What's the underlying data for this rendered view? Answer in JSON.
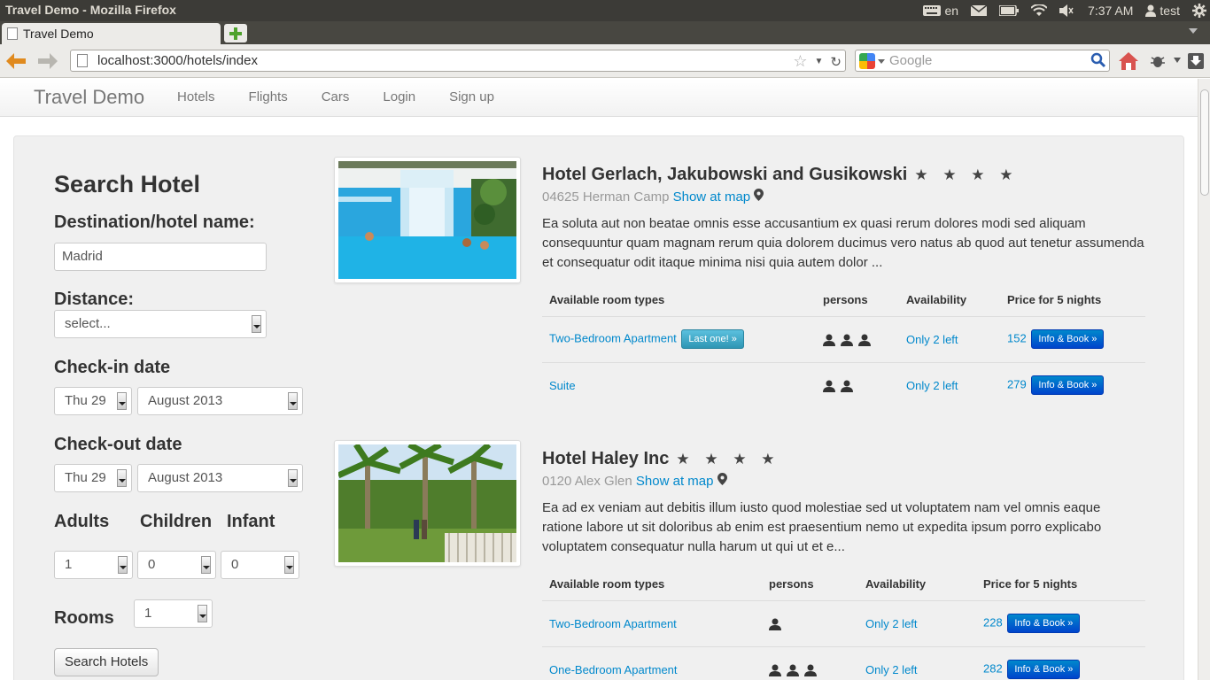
{
  "window": {
    "title": "Travel Demo - Mozilla Firefox",
    "tray": {
      "keyboard_layout": "en",
      "clock": "7:37 AM",
      "user": "test"
    }
  },
  "browser": {
    "tab_title": "Travel Demo",
    "url": "localhost:3000/hotels/index",
    "search_placeholder": "Google"
  },
  "site": {
    "brand": "Travel Demo",
    "nav": [
      "Hotels",
      "Flights",
      "Cars",
      "Login",
      "Sign up"
    ]
  },
  "search_form": {
    "title": "Search Hotel",
    "destination_label": "Destination/hotel name:",
    "destination_value": "Madrid",
    "distance_label": "Distance:",
    "distance_value": "select...",
    "checkin_label": "Check-in date",
    "checkin_day": "Thu 29",
    "checkin_month": "August 2013",
    "checkout_label": "Check-out date",
    "checkout_day": "Thu 29",
    "checkout_month": "August 2013",
    "adults_label": "Adults",
    "children_label": "Children",
    "infant_label": "Infant",
    "adults_value": "1",
    "children_value": "0",
    "infant_value": "0",
    "rooms_label": "Rooms",
    "rooms_value": "1",
    "submit_label": "Search Hotels"
  },
  "hotels": [
    {
      "name": "Hotel Gerlach, Jakubowski and Gusikowski",
      "stars": "★ ★ ★ ★",
      "address": "04625 Herman Camp",
      "map_link": "Show at map",
      "description": "Ea soluta aut non beatae omnis esse accusantium ex quasi rerum dolores modi sed aliquam consequuntur quam magnam rerum quia dolorem ducimus vero natus ab quod aut tenetur assumenda et consequatur odit itaque minima nisi quia autem dolor ...",
      "table_headers": [
        "Available room types",
        "persons",
        "Availability",
        "Price for 5 nights"
      ],
      "rooms": [
        {
          "type": "Two-Bedroom Apartment",
          "badge": "Last one! »",
          "persons": 3,
          "availability": "Only 2 left",
          "price": "152",
          "book": "Info & Book »"
        },
        {
          "type": "Suite",
          "badge": "",
          "persons": 2,
          "availability": "Only 2 left",
          "price": "279",
          "book": "Info & Book »"
        }
      ]
    },
    {
      "name": "Hotel Haley Inc",
      "stars": "★ ★ ★ ★",
      "address": "0120 Alex Glen",
      "map_link": "Show at map",
      "description": "Ea ad ex veniam aut debitis illum iusto quod molestiae sed ut voluptatem nam vel omnis eaque ratione labore ut sit doloribus ab enim est praesentium nemo ut expedita ipsum porro explicabo voluptatem consequatur nulla harum ut qui ut et e...",
      "table_headers": [
        "Available room types",
        "persons",
        "Availability",
        "Price for 5 nights"
      ],
      "rooms": [
        {
          "type": "Two-Bedroom Apartment",
          "badge": "",
          "persons": 1,
          "availability": "Only 2 left",
          "price": "228",
          "book": "Info & Book »"
        },
        {
          "type": "One-Bedroom Apartment",
          "badge": "",
          "persons": 3,
          "availability": "Only 2 left",
          "price": "282",
          "book": "Info & Book »"
        }
      ]
    }
  ],
  "colors": {
    "link": "#0088cc",
    "book_button": "#0055cc",
    "badge_button": "#49afcd",
    "panel_bg": "#f0f0f0"
  }
}
